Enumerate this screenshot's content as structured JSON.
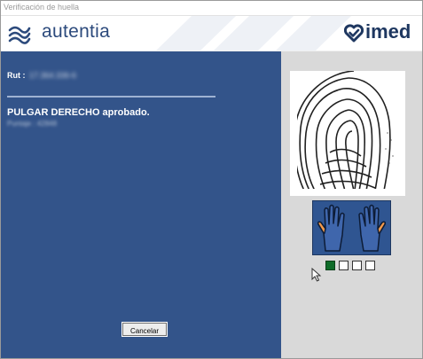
{
  "window": {
    "title": "Verificación de huella"
  },
  "banner": {
    "left_brand": "autentia",
    "right_brand": "imed"
  },
  "left_panel": {
    "rut_label": "Rut :",
    "rut_value": "17.364.336-6",
    "status_message": "PULGAR DERECHO aprobado.",
    "score_text": "Puntaje : 42848",
    "cancel_label": "Cancelar"
  },
  "right_panel": {
    "hands_icon": "hands-icon",
    "fingerprint_icon": "fingerprint-image",
    "steps": [
      {
        "state": "done"
      },
      {
        "state": "pending"
      },
      {
        "state": "pending"
      },
      {
        "state": "pending"
      }
    ]
  },
  "colors": {
    "left_panel_bg": "#33548a",
    "right_panel_bg": "#d9d9d9",
    "brand_blue": "#2c4a7c",
    "hand_highlight": "#f39a4a",
    "step_done": "#0e6b28"
  }
}
